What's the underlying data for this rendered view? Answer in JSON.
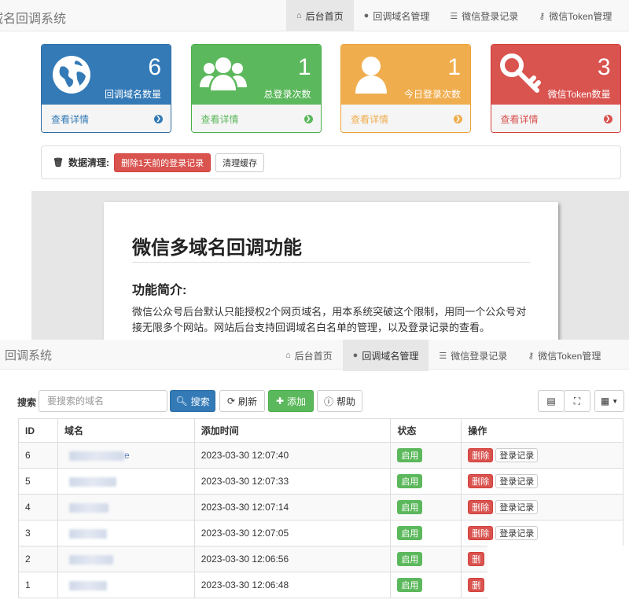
{
  "top": {
    "brand": "域名回调系统",
    "nav": [
      {
        "icon": "home-icon",
        "glyph": "⌂",
        "label": "后台首页",
        "active": true
      },
      {
        "icon": "globe-icon",
        "glyph": "●",
        "label": "回调域名管理",
        "active": false
      },
      {
        "icon": "list-icon",
        "glyph": "☰",
        "label": "微信登录记录",
        "active": false
      },
      {
        "icon": "key-icon",
        "glyph": "⚷",
        "label": "微信Token管理",
        "active": false
      }
    ],
    "tiles": [
      {
        "num": "6",
        "label": "回调域名数量",
        "link": "查看详情",
        "color": "#337ab7",
        "icon": "globe-icon"
      },
      {
        "num": "1",
        "label": "总登录次数",
        "link": "查看详情",
        "color": "#5cb85c",
        "icon": "users-icon"
      },
      {
        "num": "1",
        "label": "今日登录次数",
        "link": "查看详情",
        "color": "#f0ad4e",
        "icon": "user-icon"
      },
      {
        "num": "3",
        "label": "微信Token数量",
        "link": "查看详情",
        "color": "#d9534f",
        "icon": "key-icon"
      }
    ],
    "clean": {
      "title": "数据清理:",
      "delete_btn": "删除1天前的登录记录",
      "cache_btn": "清理缓存"
    },
    "doc": {
      "title": "微信多域名回调功能",
      "subtitle": "功能简介:",
      "text": "微信公众号后台默认只能授权2个网页域名，用本系统突破这个限制，用同一个公众号对接无限多个网站。网站后台支持回调域名白名单的管理，以及登录记录的查看。"
    }
  },
  "bottom": {
    "brand": "回调系统",
    "nav": [
      {
        "icon": "home-icon",
        "glyph": "⌂",
        "label": "后台首页",
        "active": false
      },
      {
        "icon": "globe-icon",
        "glyph": "●",
        "label": "回调域名管理",
        "active": true
      },
      {
        "icon": "list-icon",
        "glyph": "☰",
        "label": "微信登录记录",
        "active": false
      },
      {
        "icon": "key-icon",
        "glyph": "⚷",
        "label": "微信Token管理",
        "active": false
      }
    ],
    "toolbar": {
      "search_label": "搜索",
      "search_placeholder": "要搜索的域名",
      "search_btn": "搜索",
      "refresh_btn": "刷新",
      "add_btn": "添加",
      "help_btn": "帮助"
    },
    "table": {
      "headers": [
        "ID",
        "域名",
        "添加时间",
        "状态",
        "操作"
      ],
      "rows": [
        {
          "id": "6",
          "domain_tail": "e",
          "time": "2023-03-30 12:07:40",
          "status": "启用",
          "del": "删除",
          "log": "登录记录"
        },
        {
          "id": "5",
          "domain_tail": "",
          "time": "2023-03-30 12:07:33",
          "status": "启用",
          "del": "删除",
          "log": "登录记录"
        },
        {
          "id": "4",
          "domain_tail": "",
          "time": "2023-03-30 12:07:14",
          "status": "启用",
          "del": "删除",
          "log": "登录记录"
        },
        {
          "id": "3",
          "domain_tail": "",
          "time": "2023-03-30 12:07:05",
          "status": "启用",
          "del": "删除",
          "log": "登录记录"
        },
        {
          "id": "2",
          "domain_tail": "",
          "time": "2023-03-30 12:06:56",
          "status": "启用",
          "del": "删",
          "log": ""
        },
        {
          "id": "1",
          "domain_tail": "",
          "time": "2023-03-30 12:06:48",
          "status": "启用",
          "del": "删",
          "log": ""
        }
      ]
    }
  }
}
